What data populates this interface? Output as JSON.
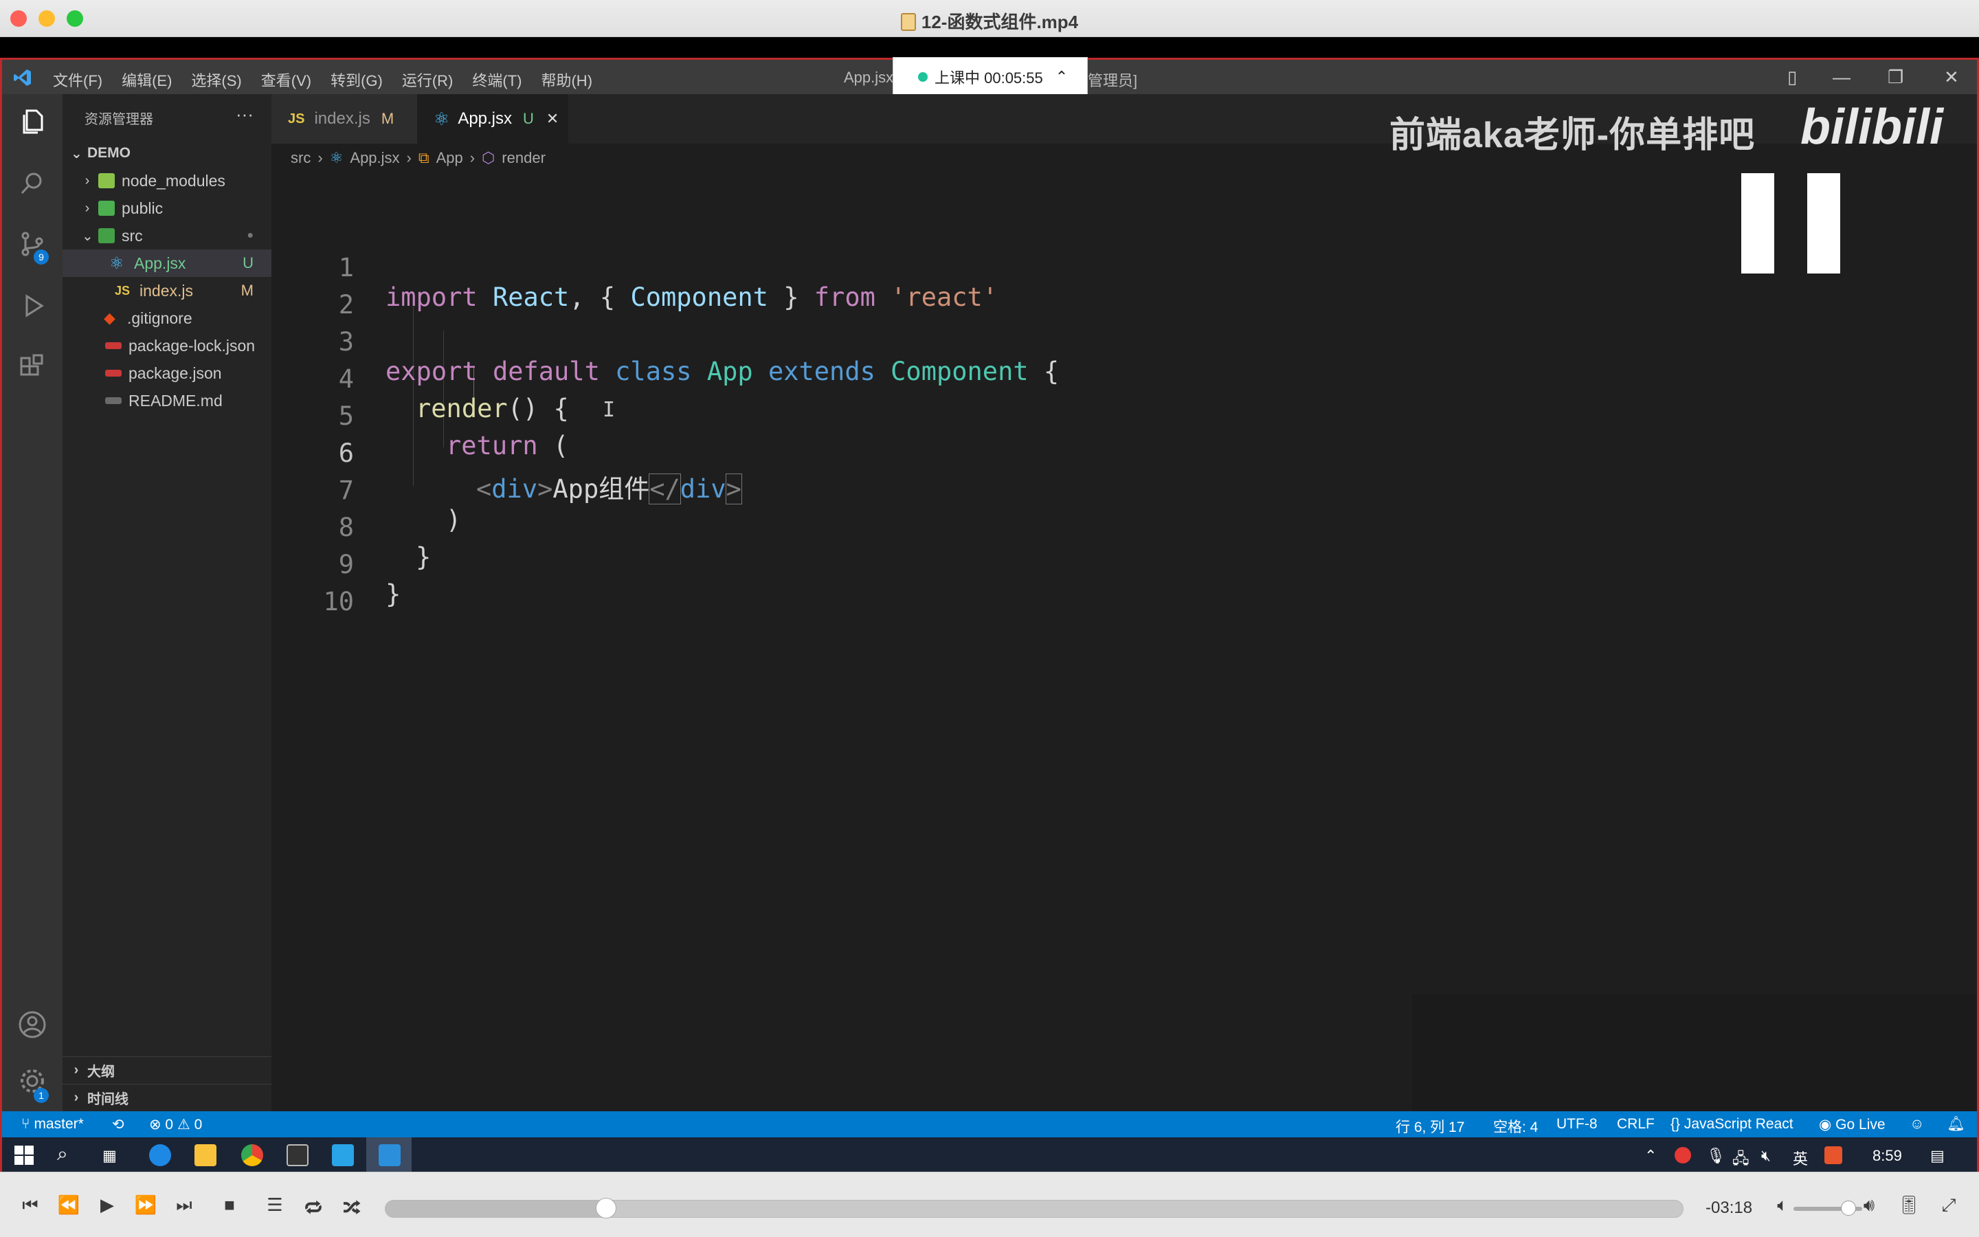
{
  "player_window": {
    "title": "12-函数式组件.mp4"
  },
  "vscode": {
    "menu": [
      "文件(F)",
      "编辑(E)",
      "选择(S)",
      "查看(V)",
      "转到(G)",
      "运行(R)",
      "终端(T)",
      "帮助(H)"
    ],
    "window_title_left": "App.jsx",
    "window_title_right": "管理员]",
    "class_badge": {
      "text": "上课中 00:05:55"
    },
    "sidebar": {
      "header": "资源管理器",
      "root": "DEMO",
      "tree": [
        {
          "name": "node_modules",
          "kind": "folder",
          "status": ""
        },
        {
          "name": "public",
          "kind": "folder",
          "status": ""
        },
        {
          "name": "src",
          "kind": "folder-open",
          "status": "●"
        },
        {
          "name": "App.jsx",
          "kind": "react",
          "status": "U"
        },
        {
          "name": "index.js",
          "kind": "js",
          "status": "M"
        },
        {
          "name": ".gitignore",
          "kind": "git",
          "status": ""
        },
        {
          "name": "package-lock.json",
          "kind": "npm",
          "status": ""
        },
        {
          "name": "package.json",
          "kind": "npm",
          "status": ""
        },
        {
          "name": "README.md",
          "kind": "md",
          "status": ""
        }
      ],
      "outline": "大纲",
      "timeline": "时间线"
    },
    "tabs": [
      {
        "icon": "JS",
        "label": "index.js",
        "status": "M"
      },
      {
        "icon": "react",
        "label": "App.jsx",
        "status": "U"
      }
    ],
    "breadcrumb": [
      "src",
      "App.jsx",
      "App",
      "render"
    ],
    "code_lines": [
      "1",
      "2",
      "3",
      "4",
      "5",
      "6",
      "7",
      "8",
      "9",
      "10"
    ],
    "code": {
      "l1": {
        "import": "import",
        "react_id": "React",
        "comma": ", {",
        "component": "Component",
        "close": "}",
        "from": "from",
        "str": "'react'"
      },
      "l3": {
        "export": "export",
        "default": "default",
        "class": "class",
        "app": "App",
        "extends": "extends",
        "component": "Component",
        "brace": "{"
      },
      "l4": {
        "render": "render",
        "paren": "() {"
      },
      "l5": {
        "return": "return",
        "paren": "("
      },
      "l6": {
        "open_lt": "<",
        "div": "div",
        "open_gt": ">",
        "text": "App组件",
        "close_lt": "</",
        "close_div": "div",
        "close_gt": ">"
      },
      "l7": ")",
      "l8": "}",
      "l9": "}"
    },
    "statusbar": {
      "branch": "master*",
      "problems": "⊗ 0 ⚠ 0",
      "position": "行 6, 列 17",
      "spaces": "空格: 4",
      "encoding": "UTF-8",
      "eol": "CRLF",
      "language": "JavaScript React",
      "golive": "Go Live"
    }
  },
  "watermark": {
    "text": "前端aka老师-你单排吧",
    "logo": "bilibili"
  },
  "taskbar": {
    "ime": "英",
    "clock": "8:59"
  },
  "player": {
    "time_remaining": "-03:18",
    "progress": 0.17,
    "volume": 0.8
  },
  "colors": {
    "accent": "#007acc",
    "close_button": "#fe5f57",
    "minimize_button": "#febc2e",
    "zoom_button": "#28c840"
  }
}
